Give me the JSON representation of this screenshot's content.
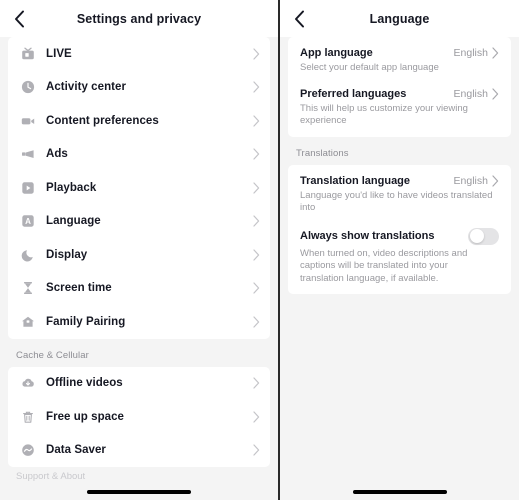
{
  "left_panel": {
    "header": {
      "title": "Settings and privacy",
      "back_icon": "chevron-left-icon"
    },
    "groups": [
      {
        "label": "",
        "items": [
          {
            "label": "LIVE",
            "icon": "live-tv-icon"
          },
          {
            "label": "Activity center",
            "icon": "clock-icon"
          },
          {
            "label": "Content preferences",
            "icon": "video-camera-icon"
          },
          {
            "label": "Ads",
            "icon": "megaphone-icon"
          },
          {
            "label": "Playback",
            "icon": "play-square-icon"
          },
          {
            "label": "Language",
            "icon": "letter-a-square-icon"
          },
          {
            "label": "Display",
            "icon": "moon-icon"
          },
          {
            "label": "Screen time",
            "icon": "hourglass-icon"
          },
          {
            "label": "Family Pairing",
            "icon": "house-icon"
          }
        ]
      },
      {
        "label": "Cache & Cellular",
        "items": [
          {
            "label": "Offline videos",
            "icon": "cloud-download-icon"
          },
          {
            "label": "Free up space",
            "icon": "trash-icon"
          },
          {
            "label": "Data Saver",
            "icon": "data-saver-icon"
          }
        ]
      }
    ],
    "cut_off_label": "Support & About"
  },
  "right_panel": {
    "header": {
      "title": "Language",
      "back_icon": "chevron-left-icon"
    },
    "groups": [
      {
        "label": "",
        "items": [
          {
            "title": "App language",
            "value": "English",
            "subtitle": "Select your default app language",
            "control": "chevron"
          },
          {
            "title": "Preferred languages",
            "value": "English",
            "subtitle": "This will help us customize your viewing experience",
            "control": "chevron"
          }
        ]
      },
      {
        "label": "Translations",
        "items": [
          {
            "title": "Translation language",
            "value": "English",
            "subtitle": "Language you'd like to have videos translated into",
            "control": "chevron"
          },
          {
            "title": "Always show translations",
            "value": "",
            "subtitle": "When turned on, video descriptions and captions will be translated into your translation language, if available.",
            "control": "toggle",
            "toggle_on": false
          }
        ]
      }
    ]
  },
  "colors": {
    "background": "#f4f4f4",
    "card": "#ffffff",
    "text_primary": "#161823",
    "text_secondary": "#9a9a9f",
    "icon_gray": "#b0b0b5",
    "chevron": "#c4c4c8",
    "toggle_off_track": "#e4e4e6",
    "divider": "#2a2a2a",
    "home_indicator": "#000000"
  }
}
